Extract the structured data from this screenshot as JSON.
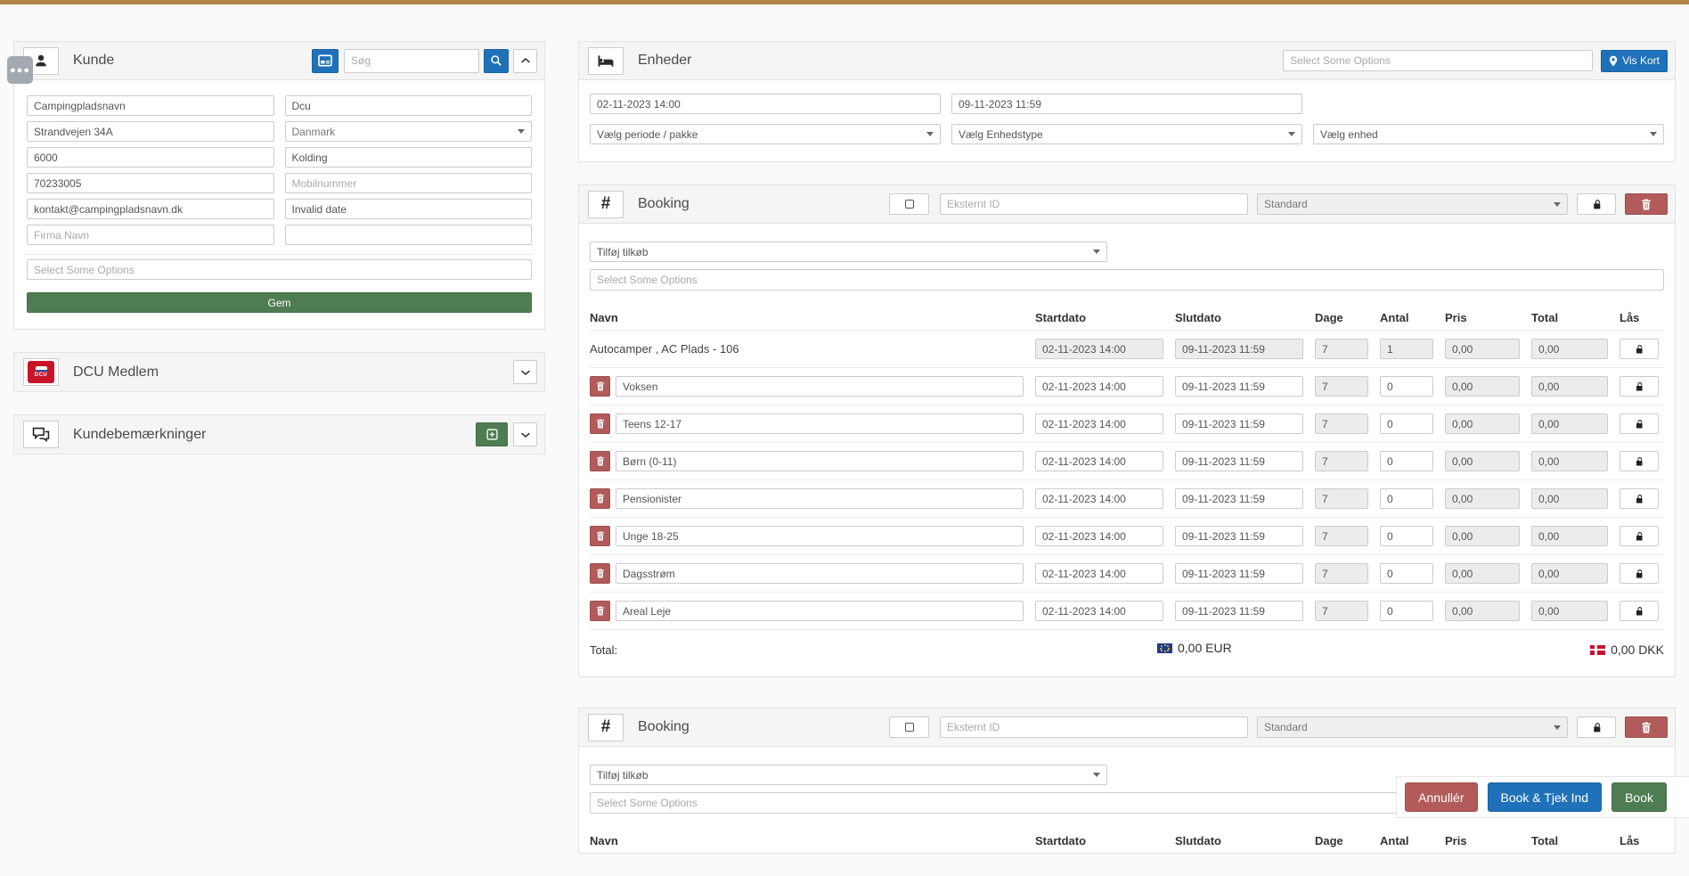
{
  "kunde": {
    "title": "Kunde",
    "search_placeholder": "Søg",
    "fields": {
      "name": "Campingpladsnavn",
      "contact": "Dcu",
      "address": "Strandvejen 34A",
      "country": "Danmark",
      "zip": "6000",
      "city": "Kolding",
      "phone": "70233005",
      "mobile_placeholder": "Mobilnummer",
      "email": "kontakt@campingpladsnavn.dk",
      "date": "Invalid date",
      "company_placeholder": "Firma Navn"
    },
    "tags_placeholder": "Select Some Options",
    "save_label": "Gem"
  },
  "dcu_medlem": {
    "title": "DCU Medlem",
    "logo_text": "DCU"
  },
  "kundebemaerkninger": {
    "title": "Kundebemærkninger"
  },
  "enheder": {
    "title": "Enheder",
    "filter_placeholder": "Select Some Options",
    "vis_kort_label": "Vis Kort",
    "start_date": "02-11-2023 14:00",
    "end_date": "09-11-2023 11:59",
    "period_label": "Vælg periode / pakke",
    "unit_type_label": "Vælg Enhedstype",
    "unit_label": "Vælg enhed"
  },
  "booking1": {
    "title": "Booking",
    "extern_id_placeholder": "Eksternt ID",
    "status_label": "Standard",
    "addons_label": "Tilføj tilkøb",
    "options_placeholder": "Select Some Options",
    "columns": [
      "Navn",
      "Startdato",
      "Slutdato",
      "Dage",
      "Antal",
      "Pris",
      "Total",
      "Lås"
    ],
    "unit_row": {
      "name": "Autocamper , AC Plads - 106",
      "start": "02-11-2023 14:00",
      "end": "09-11-2023 11:59",
      "days": "7",
      "qty": "1",
      "price": "0,00",
      "total": "0,00"
    },
    "rows": [
      {
        "name": "Voksen",
        "start": "02-11-2023 14:00",
        "end": "09-11-2023 11:59",
        "days": "7",
        "qty": "0",
        "price": "0,00",
        "total": "0,00"
      },
      {
        "name": "Teens 12-17",
        "start": "02-11-2023 14:00",
        "end": "09-11-2023 11:59",
        "days": "7",
        "qty": "0",
        "price": "0,00",
        "total": "0,00"
      },
      {
        "name": "Børn (0-11)",
        "start": "02-11-2023 14:00",
        "end": "09-11-2023 11:59",
        "days": "7",
        "qty": "0",
        "price": "0,00",
        "total": "0,00"
      },
      {
        "name": "Pensionister",
        "start": "02-11-2023 14:00",
        "end": "09-11-2023 11:59",
        "days": "7",
        "qty": "0",
        "price": "0,00",
        "total": "0,00"
      },
      {
        "name": "Unge 18-25",
        "start": "02-11-2023 14:00",
        "end": "09-11-2023 11:59",
        "days": "7",
        "qty": "0",
        "price": "0,00",
        "total": "0,00"
      },
      {
        "name": "Dagsstrøm",
        "start": "02-11-2023 14:00",
        "end": "09-11-2023 11:59",
        "days": "7",
        "qty": "0",
        "price": "0,00",
        "total": "0,00"
      },
      {
        "name": "Areal Leje",
        "start": "02-11-2023 14:00",
        "end": "09-11-2023 11:59",
        "days": "7",
        "qty": "0",
        "price": "0,00",
        "total": "0,00"
      }
    ],
    "total_label": "Total:",
    "total_eur": "0,00 EUR",
    "total_dkk": "0,00 DKK"
  },
  "booking2": {
    "title": "Booking",
    "extern_id_placeholder": "Eksternt ID",
    "status_label": "Standard",
    "addons_label": "Tilføj tilkøb",
    "options_placeholder": "Select Some Options",
    "columns": [
      "Navn",
      "Startdato",
      "Slutdato",
      "Dage",
      "Antal",
      "Pris",
      "Total",
      "Lås"
    ]
  },
  "footer": {
    "cancel": "Annullér",
    "book_checkin": "Book & Tjek Ind",
    "book": "Book"
  },
  "colors": {
    "topbar": "#b0864a",
    "accent_blue": "#1f72b9",
    "accent_green": "#4e7d51",
    "accent_red": "#b25b5b"
  }
}
